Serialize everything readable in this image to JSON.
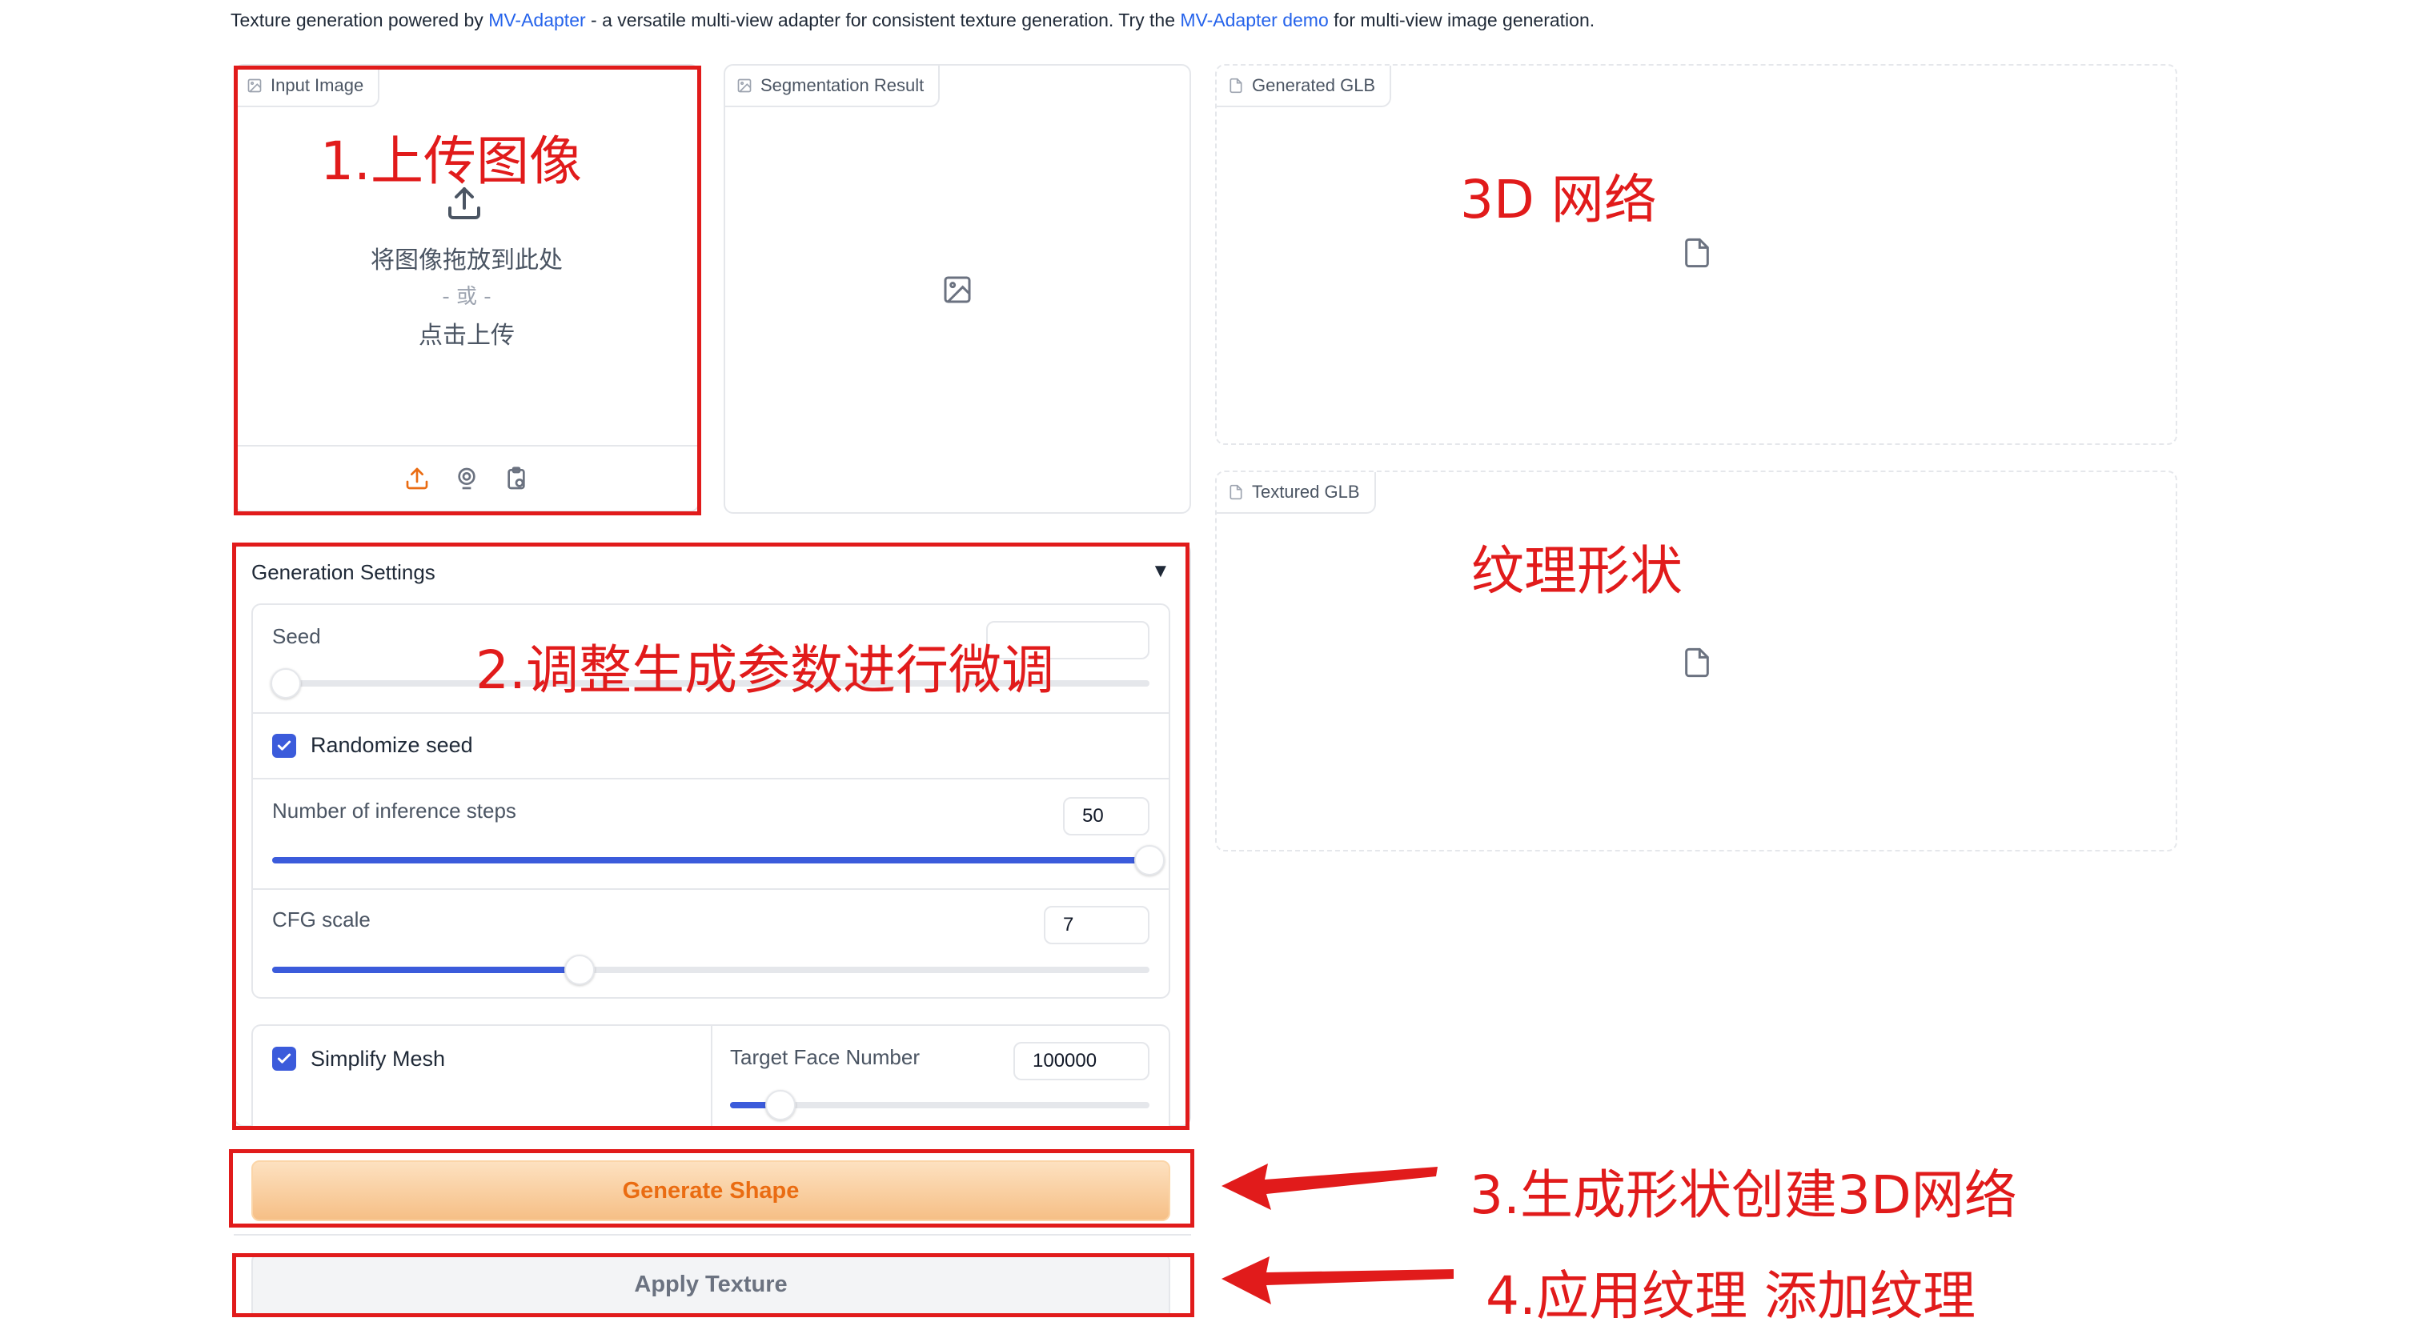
{
  "description": {
    "prefix": "Texture generation powered by ",
    "link1": "MV-Adapter",
    "middle": " - a versatile multi-view adapter for consistent texture generation. Try the ",
    "link2": "MV-Adapter demo",
    "suffix": " for multi-view image generation."
  },
  "input_image": {
    "label": "Input Image",
    "drop_text": "将图像拖放到此处",
    "or_text": "- 或 -",
    "click_text": "点击上传"
  },
  "segmentation": {
    "label": "Segmentation Result"
  },
  "generated_glb": {
    "label": "Generated GLB"
  },
  "textured_glb": {
    "label": "Textured GLB"
  },
  "settings": {
    "title": "Generation Settings",
    "seed": {
      "label": "Seed",
      "value": "",
      "fraction": 0.0
    },
    "randomize": {
      "label": "Randomize seed",
      "checked": true
    },
    "steps": {
      "label": "Number of inference steps",
      "value": "50",
      "fraction": 1.0
    },
    "cfg": {
      "label": "CFG scale",
      "value": "7",
      "fraction": 0.35
    },
    "simplify": {
      "label": "Simplify Mesh",
      "checked": true
    },
    "target_face": {
      "label": "Target Face Number",
      "value": "100000",
      "fraction": 0.12
    }
  },
  "buttons": {
    "generate": "Generate Shape",
    "apply": "Apply Texture"
  },
  "annotations": {
    "a1": "1.上传图像",
    "a2": "2.调整生成参数进行微调",
    "a3d": "3D 网络",
    "atex": "纹理形状",
    "a3": "3.生成形状创建3D网络",
    "a4": "4.应用纹理 添加纹理"
  },
  "colors": {
    "accent": "#3b5bdb",
    "annotation": "#e11b1b",
    "primary_button_text": "#ea6c12"
  }
}
